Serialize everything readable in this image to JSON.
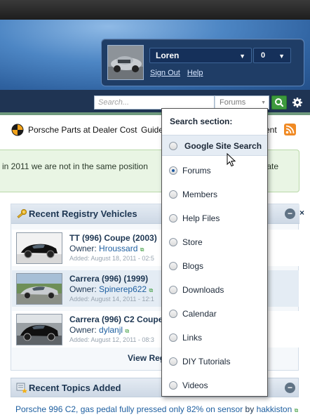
{
  "user": {
    "name": "Loren",
    "count": "0",
    "links": [
      "Sign Out",
      "Help"
    ]
  },
  "search": {
    "placeholder": "Search...",
    "section_selected": "Forums"
  },
  "quick_links": {
    "parts": "Porsche Parts at Dealer Cost",
    "guide": "Guide",
    "ent": "ent"
  },
  "announcement": {
    "text": "in 2011 we are not in the same position",
    "tail": "onate"
  },
  "registry": {
    "title": "Recent Registry Vehicles",
    "owner_label": "Owner:",
    "vehicles": [
      {
        "title": "TT (996) Coupe (2003)",
        "owner": "Hroussard",
        "added": "Added: August 18, 2011 - 02:5"
      },
      {
        "title": "Carrera (996) (1999)",
        "owner": "Spinerep622",
        "added": "Added: August 14, 2011 - 12:1"
      },
      {
        "title": "Carrera (996) C2 Coupe",
        "owner": "dylanjl",
        "added": "Added: August 12, 2011 - 08:3"
      }
    ],
    "view_link": "View Reg"
  },
  "topics": {
    "title": "Recent Topics Added",
    "first_topic": "Porsche 996 C2, gas pedal fully pressed only 82% on sensor",
    "by": "by",
    "author": "hakkiston"
  },
  "dropdown": {
    "header": "Search section:",
    "options": [
      {
        "label": "Google Site Search",
        "selected": false
      },
      {
        "label": "Forums",
        "selected": true
      },
      {
        "label": "Members",
        "selected": false
      },
      {
        "label": "Help Files",
        "selected": false
      },
      {
        "label": "Store",
        "selected": false
      },
      {
        "label": "Blogs",
        "selected": false
      },
      {
        "label": "Downloads",
        "selected": false
      },
      {
        "label": "Calendar",
        "selected": false
      },
      {
        "label": "Links",
        "selected": false
      },
      {
        "label": "DIY Tutorials",
        "selected": false
      },
      {
        "label": "Videos",
        "selected": false
      }
    ]
  },
  "colors": {
    "header_blue": "#3a6fb0",
    "nav_dark": "#1f3453",
    "search_button_green": "#3d9a3d",
    "link_blue": "#1e5fa0",
    "announcement_bg": "#e9f5e4"
  }
}
